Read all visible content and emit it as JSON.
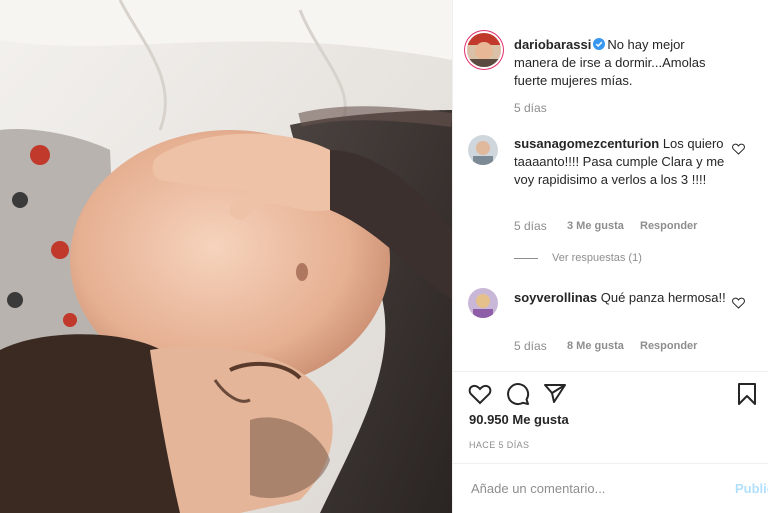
{
  "post": {
    "author": "dariobarassi",
    "caption": "No hay mejor manera de irse a dormir...Amolas fuerte mujeres mías.",
    "caption_time": "5 días",
    "likes": "90.950 Me gusta",
    "posted_ago": "HACE 5 DÍAS"
  },
  "comments": [
    {
      "user": "susanagomezcenturion",
      "text": "Los quiero taaaanto!!!! Pasa cumple Clara y me voy rapidisimo a verlos a los 3 !!!!",
      "time": "5 días",
      "likes": "3 Me gusta",
      "reply": "Responder"
    },
    {
      "user": "soyverollinas",
      "text": "Qué panza hermosa!!",
      "time": "5 días",
      "likes": "8 Me gusta",
      "reply": "Responder"
    }
  ],
  "view_replies": "Ver respuestas (1)",
  "comment_box": {
    "placeholder": "Añade un comentario...",
    "publish_label": "Publicar"
  },
  "icons": {
    "like": "heart-icon",
    "comment": "comment-bubble-icon",
    "share": "share-icon",
    "save": "bookmark-icon",
    "verified": "verified-badge-icon"
  },
  "colors": {
    "text": "#262626",
    "muted": "#8e8e8e",
    "verified": "#3897f0",
    "publish_disabled": "#b2dffc",
    "divider": "#efefef"
  }
}
